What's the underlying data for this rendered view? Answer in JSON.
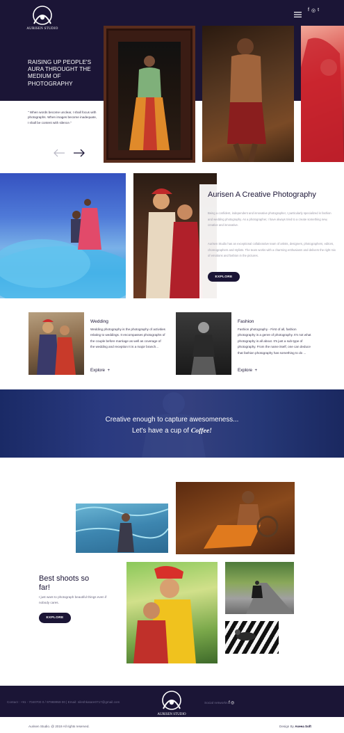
{
  "brand": {
    "name": "AURISEN STUDIO"
  },
  "colors": {
    "primary": "#1b1536",
    "accent": "#ffffff",
    "muted": "#9a98a6"
  },
  "nav": {
    "menu_icon": "hamburger-menu-icon",
    "social": [
      "f",
      "◎",
      "t"
    ]
  },
  "hero": {
    "heading": "RAISING UP PEOPLE'S AURA THROUGHT THE MEDIUM OF PHOTOGRAPHY",
    "quote": "\" When words become unclear, I shall focus with photographs. When images become inadequate, I shall be content with silence.\""
  },
  "about": {
    "title": "Aurisen A Creative Photography",
    "para1": "Being a confident, independent and innovative photographer, I particularly specialized in fashion and wedding photography. As a photographer, I have always tried to a create something new, creative and innovative.",
    "para2": "Aurisen Studio has an exceptional collaborative team of artists, designers, photographers, editors, choreographers and stylists. The team works with a charming enthusiasm and delivers the right mix of emotions and fashion in the pictures.",
    "button": "EXPLORE"
  },
  "services": [
    {
      "title": "Wedding",
      "text": "Wedding photography is the photography of activities relating to weddings. It encompasses photographs of the couple before marriage as well as coverage of the wedding and reception It is a major branch...",
      "link": "Explore"
    },
    {
      "title": "Fashion",
      "text": "Fashion photography - First of all, fashion photography is a genre of photography. It's not what photography is all about. It's just a sub-type of photography. From the name itself, one can deduce that fashion photography has something to do ...",
      "link": "Explore"
    }
  ],
  "banner": {
    "line1": "Creative enough to capture awesomeness...",
    "line2_prefix": "Let's have a cup of",
    "line2_script": "Coffee!"
  },
  "gallery": {
    "title": "Best shoots so far!",
    "text": "I just want to photograph beautiful things even if nobody cares.",
    "button": "EXPLORE"
  },
  "footer": {
    "contact": "Contact : +91 - 7040700 0 / 97969959 00 | Email: nileshkatare0717@gmail.com",
    "social_label": "Social networks",
    "social": [
      "f",
      "◎"
    ],
    "copyright": "Aurisen Studio. @ 2019 All rights reserved.",
    "design_prefix": "Design By",
    "design_name": "Aseea Soft"
  }
}
